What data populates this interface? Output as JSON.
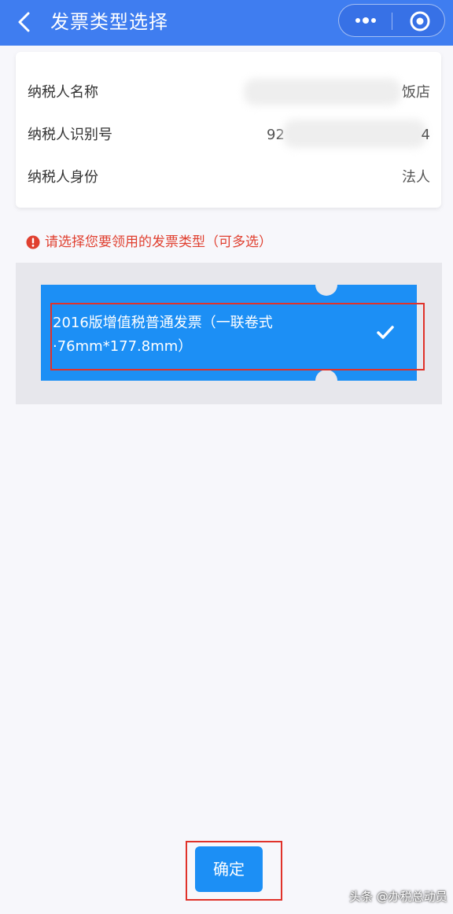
{
  "navbar": {
    "title": "发票类型选择",
    "back_icon": "chevron-left-icon",
    "more_icon": "more-dots-icon",
    "close_icon": "target-circle-icon"
  },
  "taxpayer": {
    "rows": [
      {
        "label": "纳税人名称",
        "value": "饭店"
      },
      {
        "label": "纳税人识别号",
        "value_prefix": "92",
        "value_suffix": "4"
      },
      {
        "label": "纳税人身份",
        "value": "法人"
      }
    ]
  },
  "notice": {
    "text": "请选择您要领用的发票类型（可多选）",
    "icon": "alert-circle-icon",
    "color": "#e04030"
  },
  "invoice_types": [
    {
      "label": "2016版增值税普通发票（一联卷式·76mm*177.8mm）",
      "selected": true,
      "check_icon": "check-icon"
    }
  ],
  "confirm": {
    "label": "确定"
  },
  "watermark": "头条 @办税总动员",
  "colors": {
    "navbar": "#3f7df0",
    "accent": "#1c8ff5",
    "highlight_box": "#e0322a"
  }
}
